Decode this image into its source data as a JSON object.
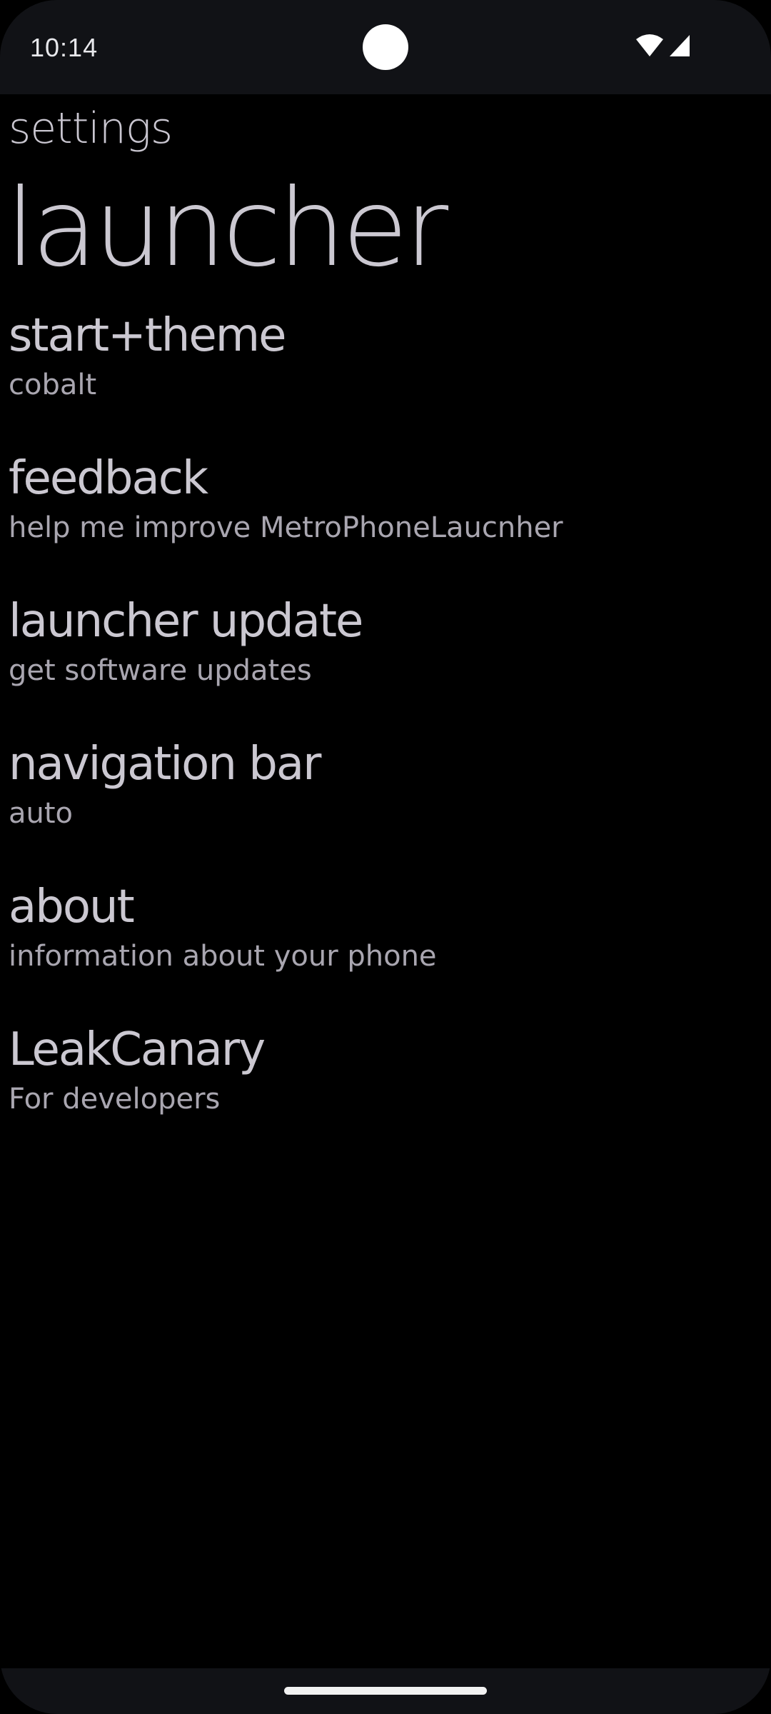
{
  "status_bar": {
    "time": "10:14",
    "icons": [
      "wifi-icon",
      "cellular-signal-icon"
    ]
  },
  "header": {
    "pivot_title": "settings",
    "page_title": "launcher"
  },
  "settings_items": [
    {
      "title": "start+theme",
      "subtitle": "cobalt"
    },
    {
      "title": "feedback",
      "subtitle": "help me improve MetroPhoneLaucnher"
    },
    {
      "title": "launcher update",
      "subtitle": "get software updates"
    },
    {
      "title": "navigation bar",
      "subtitle": "auto"
    },
    {
      "title": "about",
      "subtitle": "information about your phone"
    },
    {
      "title": "LeakCanary",
      "subtitle": "For developers"
    }
  ],
  "colors": {
    "background": "#000000",
    "primary_text": "#cbc8d1",
    "secondary_text": "#a9a6b0",
    "system_bar": "#111216"
  }
}
